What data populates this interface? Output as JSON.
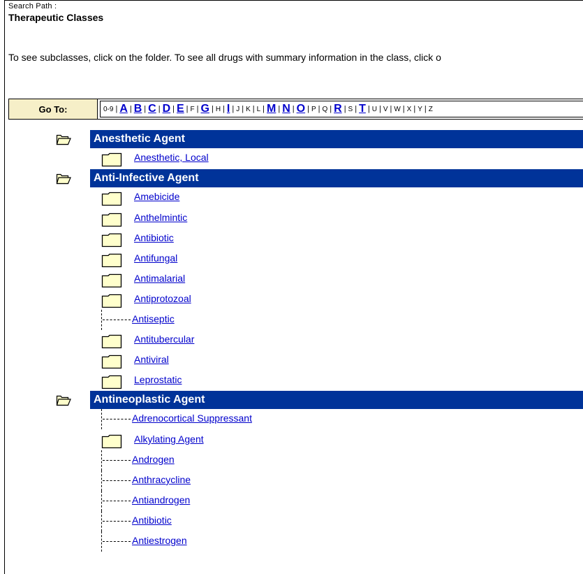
{
  "header": {
    "search_path_label": "Search Path :",
    "title": "Therapeutic Classes",
    "instructions": "To see subclasses, click on the folder. To see all drugs with summary information in the class, click o"
  },
  "goto": {
    "label": "Go To:",
    "items": [
      {
        "label": "0-9",
        "active": false
      },
      {
        "label": "A",
        "active": true
      },
      {
        "label": "B",
        "active": true
      },
      {
        "label": "C",
        "active": true
      },
      {
        "label": "D",
        "active": true
      },
      {
        "label": "E",
        "active": true
      },
      {
        "label": "F",
        "active": false
      },
      {
        "label": "G",
        "active": true
      },
      {
        "label": "H",
        "active": false
      },
      {
        "label": "I",
        "active": true
      },
      {
        "label": "J",
        "active": false
      },
      {
        "label": "K",
        "active": false
      },
      {
        "label": "L",
        "active": false
      },
      {
        "label": "M",
        "active": true
      },
      {
        "label": "N",
        "active": true
      },
      {
        "label": "O",
        "active": true
      },
      {
        "label": "P",
        "active": false
      },
      {
        "label": "Q",
        "active": false
      },
      {
        "label": "R",
        "active": true
      },
      {
        "label": "S",
        "active": false
      },
      {
        "label": "T",
        "active": true
      },
      {
        "label": "U",
        "active": false
      },
      {
        "label": "V",
        "active": false
      },
      {
        "label": "W",
        "active": false
      },
      {
        "label": "X",
        "active": false
      },
      {
        "label": "Y",
        "active": false
      },
      {
        "label": "Z",
        "active": false
      }
    ]
  },
  "categories": [
    {
      "name": "Anesthetic Agent",
      "icon": "open-folder-icon",
      "children": [
        {
          "label": "Anesthetic, Local",
          "kind": "folder"
        }
      ]
    },
    {
      "name": "Anti-Infective Agent",
      "icon": "open-folder-icon",
      "children": [
        {
          "label": "Amebicide",
          "kind": "folder"
        },
        {
          "label": "Anthelmintic",
          "kind": "folder"
        },
        {
          "label": "Antibiotic",
          "kind": "folder"
        },
        {
          "label": "Antifungal",
          "kind": "folder"
        },
        {
          "label": "Antimalarial",
          "kind": "folder"
        },
        {
          "label": "Antiprotozoal",
          "kind": "folder"
        },
        {
          "label": "Antiseptic",
          "kind": "leaf"
        },
        {
          "label": "Antitubercular",
          "kind": "folder"
        },
        {
          "label": "Antiviral",
          "kind": "folder"
        },
        {
          "label": "Leprostatic",
          "kind": "folder"
        }
      ]
    },
    {
      "name": "Antineoplastic Agent",
      "icon": "open-folder-icon",
      "children": [
        {
          "label": "Adrenocortical Suppressant",
          "kind": "leaf"
        },
        {
          "label": "Alkylating Agent",
          "kind": "folder"
        },
        {
          "label": "Androgen",
          "kind": "leaf"
        },
        {
          "label": "Anthracycline",
          "kind": "leaf"
        },
        {
          "label": "Antiandrogen",
          "kind": "leaf"
        },
        {
          "label": "Antibiotic",
          "kind": "leaf"
        },
        {
          "label": "Antiestrogen",
          "kind": "leaf"
        }
      ]
    }
  ],
  "colors": {
    "category_bar": "#003399",
    "link": "#0000cc",
    "goto_label_bg": "#f6efc8",
    "folder_fill": "#ffffcc"
  }
}
